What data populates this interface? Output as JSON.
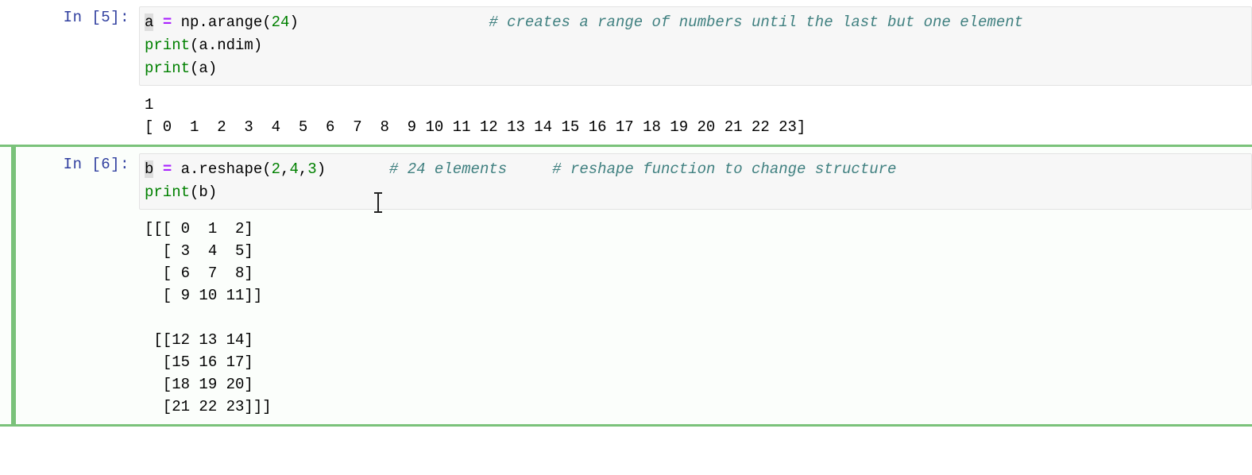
{
  "theme": {
    "prompt_color": "#303F9F",
    "comment_color": "#408080",
    "builtin_color": "#008000",
    "number_color": "#008000",
    "operator_color": "#AA22FF",
    "selected_cell_color": "#7ac27a",
    "input_background": "#f7f7f7",
    "page_background": "#ffffff"
  },
  "cells": [
    {
      "prompt": "In [5]:",
      "selected": false,
      "code": {
        "line1": {
          "variable": "a",
          "operator": "=",
          "call": "np.arange(",
          "number": "24",
          "close": ")",
          "gap": "                     ",
          "comment": "# creates a range of numbers until the last but one element"
        },
        "line2": {
          "builtin": "print",
          "rest": "(a.ndim)"
        },
        "line3": {
          "builtin": "print",
          "rest": "(a)"
        }
      },
      "output": "1\n[ 0  1  2  3  4  5  6  7  8  9 10 11 12 13 14 15 16 17 18 19 20 21 22 23]"
    },
    {
      "prompt": "In [6]:",
      "selected": true,
      "code": {
        "line1": {
          "variable": "b",
          "operator": "=",
          "call": "a.reshape(",
          "num1": "2",
          "sep1": ",",
          "num2": "4",
          "sep2": ",",
          "num3": "3",
          "close": ")",
          "gap1": "       ",
          "comment1": "# 24 elements",
          "gap2": "     ",
          "comment2": "# reshape function to change structure"
        },
        "line2": {
          "builtin": "print",
          "rest": "(b)"
        }
      },
      "output": "[[[ 0  1  2]\n  [ 3  4  5]\n  [ 6  7  8]\n  [ 9 10 11]]\n\n [[12 13 14]\n  [15 16 17]\n  [18 19 20]\n  [21 22 23]]]"
    }
  ],
  "cursor": {
    "icon": "i-beam-cursor"
  }
}
